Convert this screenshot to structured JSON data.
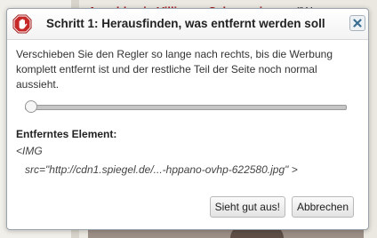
{
  "background": {
    "headline_link": "Anschlag in Villingen-Schwenningen:",
    "headline_rest": " \"Wer"
  },
  "dialog": {
    "title": "Schritt 1: Herausfinden, was entfernt werden soll",
    "icon": "stop-hand-icon",
    "close_icon": "close-icon",
    "instruction": "Verschieben Sie den Regler so lange nach rechts, bis die Werbung komplett entfernt ist und der restliche Teil der Seite noch normal aussieht.",
    "slider_value": 0,
    "removed_heading": "Entferntes Element:",
    "element_line1": "<IMG",
    "element_line2": "src=\"http://cdn1.spiegel.de/...-hppano-ovhp-622580.jpg\" >",
    "confirm_label": "Sieht gut aus!",
    "cancel_label": "Abbrechen"
  },
  "colors": {
    "accent_red": "#c62828",
    "close_blue": "#3a6f93"
  }
}
